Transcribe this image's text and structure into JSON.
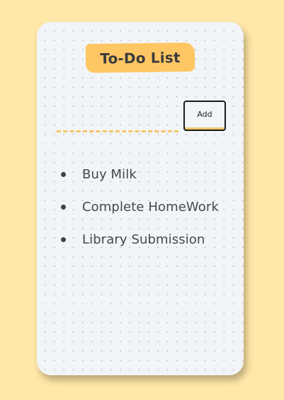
{
  "app": {
    "title": "To-Do List"
  },
  "form": {
    "input_value": "",
    "input_placeholder": "",
    "add_label": "Add"
  },
  "todos": [
    {
      "text": "Buy Milk"
    },
    {
      "text": "Complete HomeWork"
    },
    {
      "text": "Library Submission"
    }
  ],
  "colors": {
    "page_background": "#ffe8a8",
    "card_background": "#f2f5f8",
    "accent": "#ffc764",
    "text": "#45484d"
  }
}
